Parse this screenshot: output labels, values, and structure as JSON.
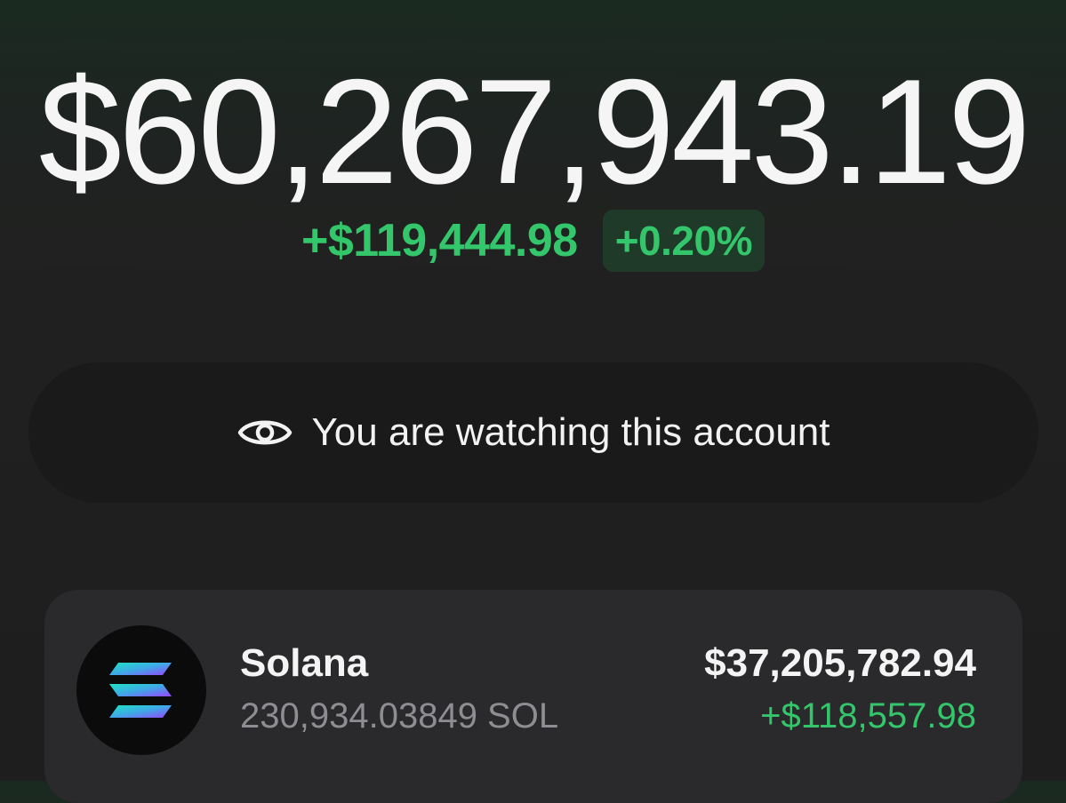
{
  "portfolio": {
    "total_balance": "$60,267,943.19",
    "change_amount": "+$119,444.98",
    "change_percent": "+0.20%"
  },
  "watch_banner": {
    "icon": "eye-icon",
    "text": "You are watching this account"
  },
  "tokens": [
    {
      "icon": "solana-logo-icon",
      "name": "Solana",
      "amount": "230,934.03849 SOL",
      "value": "$37,205,782.94",
      "change": "+$118,557.98"
    }
  ],
  "colors": {
    "positive": "#34c66b",
    "positive_bg": "#1f3a29",
    "card_bg": "#2a2a2c",
    "banner_bg": "#1a1a1b"
  }
}
